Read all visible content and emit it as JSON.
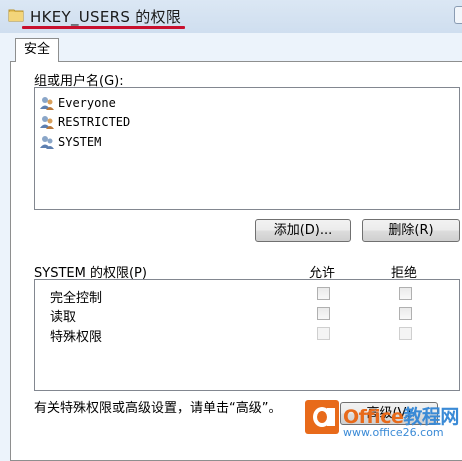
{
  "window": {
    "title": "HKEY_USERS 的权限"
  },
  "tabs": [
    {
      "label": "安全"
    }
  ],
  "group_label": "组或用户名(G):",
  "users": [
    {
      "name": "Everyone",
      "icon": "users-icon"
    },
    {
      "name": "RESTRICTED",
      "icon": "users-icon"
    },
    {
      "name": "SYSTEM",
      "icon": "users-icon"
    }
  ],
  "buttons": {
    "add": "添加(D)...",
    "remove": "删除(R)"
  },
  "permissions": {
    "label": "SYSTEM 的权限(P)",
    "allow_header": "允许",
    "deny_header": "拒绝",
    "rows": [
      {
        "name": "完全控制",
        "allow": false,
        "deny": false,
        "disabled": false
      },
      {
        "name": "读取",
        "allow": false,
        "deny": false,
        "disabled": false
      },
      {
        "name": "特殊权限",
        "allow": false,
        "deny": false,
        "disabled": true
      }
    ]
  },
  "footer": {
    "text": "有关特殊权限或高级设置，请单击“高级”。",
    "advanced_button": "高级(V)"
  },
  "watermark": {
    "brand_a": "Office",
    "brand_b": "教程网",
    "url": "www.office26.com"
  },
  "colors": {
    "accent_underline": "#c8102e",
    "watermark_orange": "#e86a1a",
    "watermark_blue": "#3a8ad6"
  }
}
